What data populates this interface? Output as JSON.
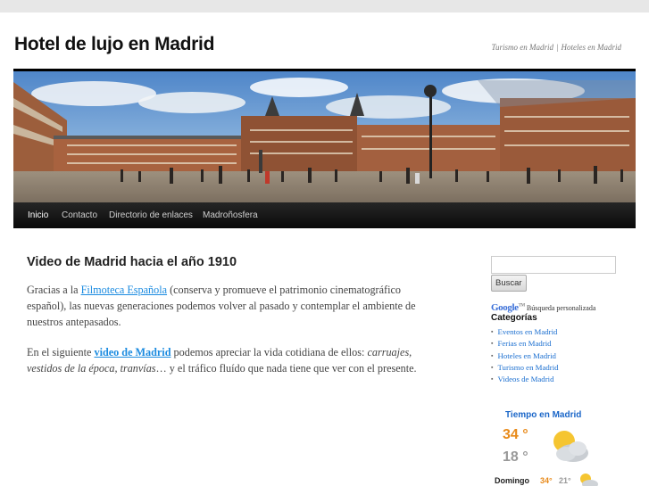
{
  "site": {
    "title": "Hotel de lujo en Madrid",
    "tagline_link1": "Turismo en Madrid",
    "tagline_separator": "|",
    "tagline_link2": "Hoteles en Madrid"
  },
  "banner": {
    "image": "panorama-plaza-mayor-madrid"
  },
  "nav": {
    "items": [
      {
        "label": "Inicio",
        "current": true
      },
      {
        "label": "Contacto"
      },
      {
        "label": "Directorio de enlaces"
      },
      {
        "label": "Madroñosfera"
      }
    ]
  },
  "post": {
    "title": "Video de Madrid hacia el año 1910",
    "p1_before": "Gracias a la ",
    "p1_link": "Filmoteca Española",
    "p1_after": " (conserva y promueve el patrimonio cinematográfico español), las nuevas generaciones podemos volver al pasado y contemplar el ambiente de nuestros antepasados.",
    "p2_before": "En el siguiente ",
    "p2_link": "video de Madrid",
    "p2_middle": " podemos apreciar la vida cotidiana de ellos: ",
    "p2_italic": "carruajes, vestidos de la época, tranvías",
    "p2_after": "… y el tráfico fluído que nada tiene que ver con el presente."
  },
  "sidebar": {
    "search": {
      "value": "",
      "placeholder": "",
      "button_label": "Buscar"
    },
    "google_logo": "Google",
    "google_tm": "TM",
    "google_text": "Búsqueda personalizada",
    "categories_title": "Categorías",
    "categories": [
      "Eventos en Madrid",
      "Ferias en Madrid",
      "Hoteles en Madrid",
      "Turismo en Madrid",
      "Videos de Madrid"
    ],
    "weather": {
      "title": "Tiempo en Madrid",
      "high": "34 °",
      "low": "18 °",
      "icon": "partly-cloudy-icon",
      "forecast_day": "Domingo",
      "forecast_high": "34°",
      "forecast_low": "21°"
    }
  },
  "colors": {
    "link": "#1b8be0",
    "weather_title": "#1a66c8",
    "temp_high": "#e88a1a",
    "temp_low": "#999999",
    "nav_bg": "#111111"
  }
}
